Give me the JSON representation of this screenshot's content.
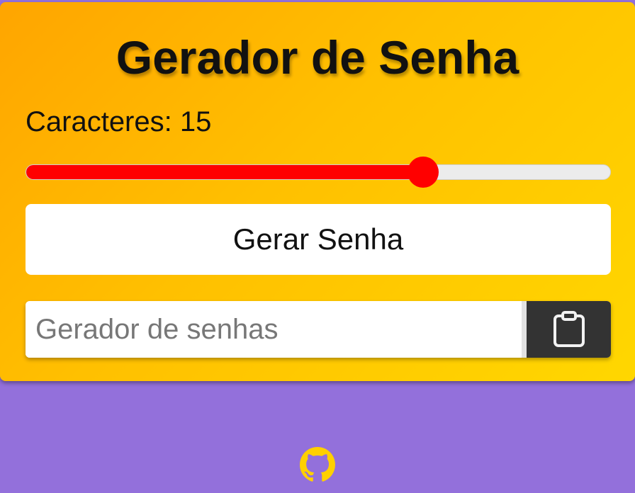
{
  "title": "Gerador de Senha",
  "length": {
    "label": "Caracteres:",
    "value": "15",
    "fraction": 0.68,
    "color": "#ff0000"
  },
  "generate_button": {
    "label": "Gerar Senha"
  },
  "output": {
    "value": "",
    "placeholder": "Gerador de senhas"
  },
  "copy_button": {
    "icon": "clipboard-icon"
  },
  "footer": {
    "icon": "github-icon",
    "icon_color": "#ffd000"
  },
  "colors": {
    "background": "#9370db",
    "card_gradient_start": "#ffa500",
    "card_gradient_end": "#ffd700",
    "copy_button_bg": "#333333"
  }
}
